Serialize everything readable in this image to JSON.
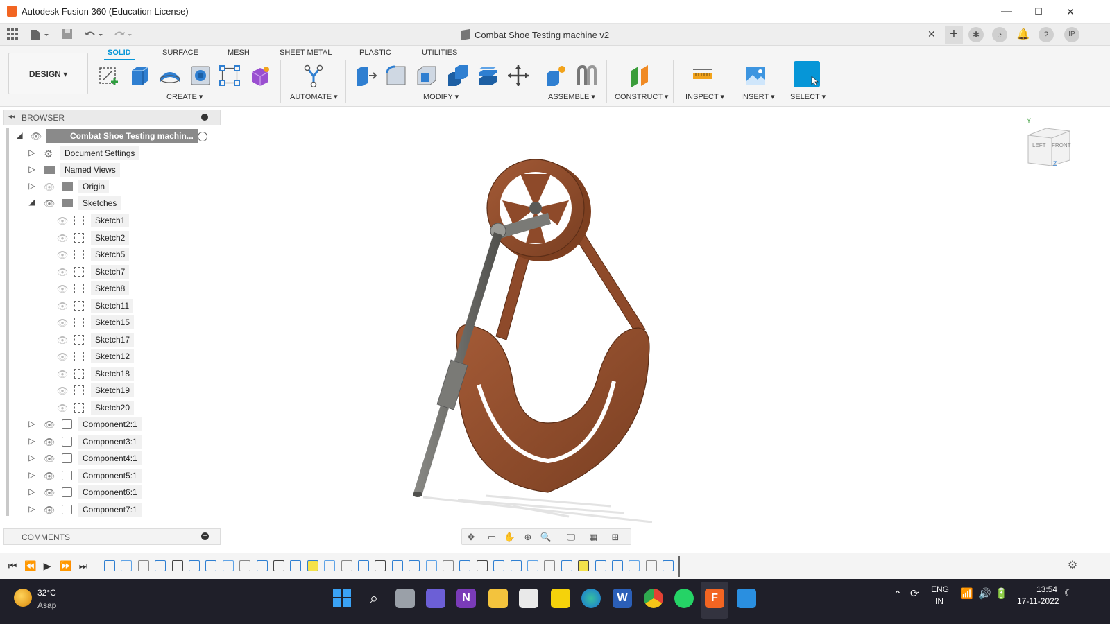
{
  "window": {
    "title": "Autodesk Fusion 360 (Education License)",
    "minimize": "—",
    "maximize": "☐",
    "close": "✕"
  },
  "document": {
    "tab_title": "Combat Shoe Testing machine v2",
    "tab_close": "✕",
    "user_initials": "IP"
  },
  "ribbon": {
    "workspace": "DESIGN ▾",
    "tabs": [
      "SOLID",
      "SURFACE",
      "MESH",
      "SHEET METAL",
      "PLASTIC",
      "UTILITIES"
    ],
    "groups": [
      "CREATE ▾",
      "AUTOMATE ▾",
      "MODIFY ▾",
      "ASSEMBLE ▾",
      "CONSTRUCT ▾",
      "INSPECT ▾",
      "INSERT ▾",
      "SELECT ▾"
    ]
  },
  "browser": {
    "header": "BROWSER",
    "root": "Combat Shoe Testing machin...",
    "items": [
      "Document Settings",
      "Named Views",
      "Origin",
      "Sketches"
    ],
    "sketches": [
      "Sketch1",
      "Sketch2",
      "Sketch5",
      "Sketch7",
      "Sketch8",
      "Sketch11",
      "Sketch15",
      "Sketch17",
      "Sketch12",
      "Sketch18",
      "Sketch19",
      "Sketch20"
    ],
    "components": [
      "Component2:1",
      "Component3:1",
      "Component4:1",
      "Component5:1",
      "Component6:1",
      "Component7:1"
    ]
  },
  "comments": {
    "header": "COMMENTS"
  },
  "viewcube": {
    "left": "LEFT",
    "front": "FRONT",
    "axis_y": "Y",
    "axis_z": "Z"
  },
  "taskbar": {
    "temperature": "32°C",
    "weather": "Asap",
    "language": "ENG",
    "region": "IN",
    "time": "13:54",
    "date": "17-11-2022"
  },
  "colors": {
    "accent": "#0696d7",
    "copper": "#8b4a2b",
    "rod": "#6b6b68",
    "taskbar": "#1f1f29"
  }
}
